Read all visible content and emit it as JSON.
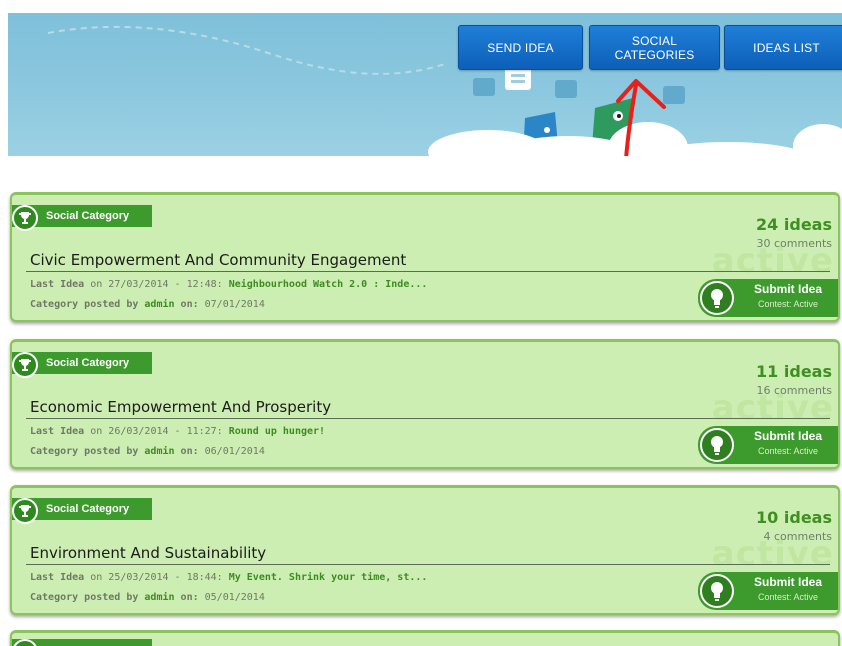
{
  "nav": {
    "send_idea": "SEND IDEA",
    "social_categories": "SOCIAL CATEGORIES",
    "ideas_list": "IDEAS LIST"
  },
  "colors": {
    "nav_button": "#1470cc",
    "banner": "#8cc8df",
    "card_bg": "#cdeeb2",
    "card_border": "#8bc35c",
    "accent_green": "#3d9a2c",
    "annotation_arrow": "#e8201a"
  },
  "icons": {
    "badge": "trophy-icon",
    "submit": "lightbulb-icon",
    "annotation": "red-arrow-annotation"
  },
  "cards": [
    {
      "badge": "Social Category",
      "ideas": "24 ideas",
      "comments": "30 comments",
      "watermark": "active",
      "title": "Civic Empowerment And Community Engagement",
      "last_idea_prefix": "Last Idea",
      "on_word": "on",
      "last_idea_date": "27/03/2014 - 12:48:",
      "last_idea_title": "Neighbourhood Watch 2.0 : Inde...",
      "posted_prefix": "Category posted by",
      "posted_by": "admin",
      "posted_on_label": "on:",
      "posted_date": "07/01/2014",
      "submit_label": "Submit Idea",
      "submit_sub": "Contest: Active"
    },
    {
      "badge": "Social Category",
      "ideas": "11 ideas",
      "comments": "16 comments",
      "watermark": "active",
      "title": "Economic Empowerment And Prosperity",
      "last_idea_prefix": "Last Idea",
      "on_word": "on",
      "last_idea_date": "26/03/2014 - 11:27:",
      "last_idea_title": "Round up hunger!",
      "posted_prefix": "Category posted by",
      "posted_by": "admin",
      "posted_on_label": "on:",
      "posted_date": "06/01/2014",
      "submit_label": "Submit Idea",
      "submit_sub": "Contest: Active"
    },
    {
      "badge": "Social Category",
      "ideas": "10 ideas",
      "comments": "4 comments",
      "watermark": "active",
      "title": "Environment And Sustainability",
      "last_idea_prefix": "Last Idea",
      "on_word": "on",
      "last_idea_date": "25/03/2014 - 18:44:",
      "last_idea_title": "My Event. Shrink your time, st...",
      "posted_prefix": "Category posted by",
      "posted_by": "admin",
      "posted_on_label": "on:",
      "posted_date": "05/01/2014",
      "submit_label": "Submit Idea",
      "submit_sub": "Contest: Active"
    }
  ]
}
